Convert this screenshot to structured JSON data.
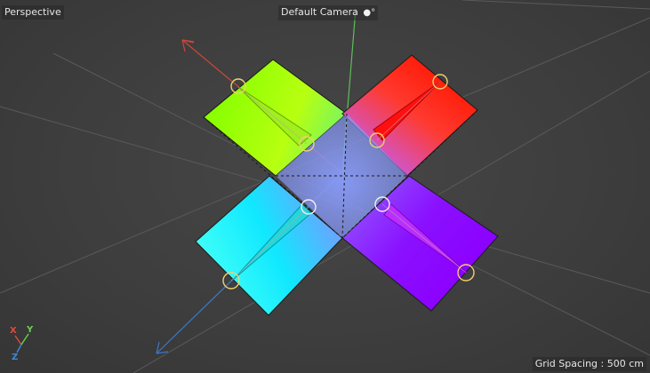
{
  "viewport": {
    "view_name": "Perspective",
    "camera_name": "Default Camera",
    "camera_icon": "camera-icon",
    "grid_spacing": "Grid Spacing : 500 cm"
  },
  "axis_gizmo": {
    "x_label": "X",
    "y_label": "Y",
    "z_label": "Z",
    "x_color": "#e04a3a",
    "y_color": "#6ad04c",
    "z_color": "#3a8ae0"
  },
  "scene": {
    "background_color": "#3d3d3d",
    "plane_colors": [
      "#7cff00",
      "#ff1a00",
      "#00ffff",
      "#8c00ff"
    ],
    "handle_color": "#f0d070"
  }
}
